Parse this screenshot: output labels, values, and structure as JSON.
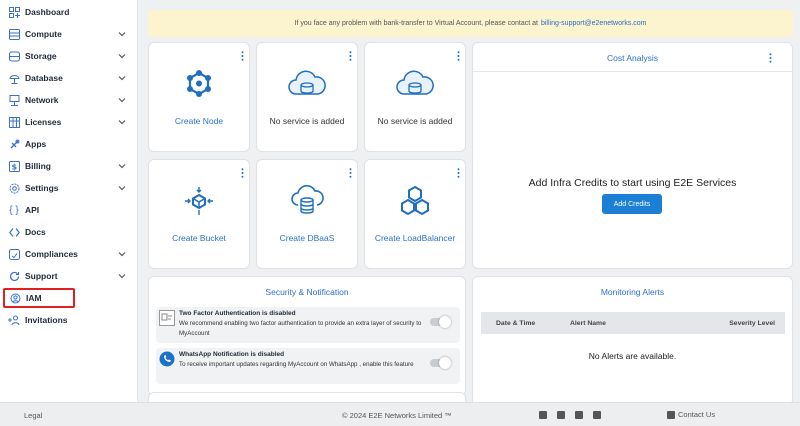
{
  "sidebar": {
    "items": [
      {
        "label": "Dashboard",
        "icon": "dashboard-icon"
      },
      {
        "label": "Compute",
        "icon": "compute-icon"
      },
      {
        "label": "Storage",
        "icon": "storage-icon"
      },
      {
        "label": "Database",
        "icon": "database-icon"
      },
      {
        "label": "Network",
        "icon": "network-icon"
      },
      {
        "label": "Licenses",
        "icon": "licenses-icon"
      },
      {
        "label": "Apps",
        "icon": "apps-icon"
      },
      {
        "label": "Billing",
        "icon": "billing-icon"
      },
      {
        "label": "Settings",
        "icon": "settings-icon"
      },
      {
        "label": "API",
        "icon": "api-icon"
      },
      {
        "label": "Docs",
        "icon": "docs-icon"
      },
      {
        "label": "Compliances",
        "icon": "compliances-icon"
      },
      {
        "label": "Support",
        "icon": "support-icon"
      },
      {
        "label": "IAM",
        "icon": "iam-icon"
      },
      {
        "label": "Invitations",
        "icon": "invitations-icon"
      }
    ]
  },
  "banner": {
    "text": "If you face any problem with bank-transfer to Virtual Account, please contact at",
    "email": "billing-support@e2enetworks.com"
  },
  "tiles": [
    {
      "label": "Create Node",
      "icon": "node-icon"
    },
    {
      "label": "No service is added",
      "icon": "cloud-icon"
    },
    {
      "label": "No service is added",
      "icon": "cloud-icon"
    },
    {
      "label": "Create Bucket",
      "icon": "bucket-icon"
    },
    {
      "label": "Create DBaaS",
      "icon": "dbaas-icon"
    },
    {
      "label": "Create LoadBalancer",
      "icon": "loadbalancer-icon"
    }
  ],
  "cost": {
    "title": "Cost Analysis",
    "message": "Add Infra Credits to start using E2E Services",
    "button": "Add Credits"
  },
  "security": {
    "title": "Security & Notification",
    "notifications": [
      {
        "title": "Two Factor Authentication is disabled",
        "description": "We recommend enabling two factor authentication to provide an extra layer of security to MyAccount"
      },
      {
        "title": "WhatsApp Notification is disabled",
        "description": "To receive important updates regarding MyAccount on WhatsApp , enable this feature"
      }
    ]
  },
  "monitoring": {
    "title": "Monitoring Alerts",
    "columns": [
      "Date & Time",
      "Alert Name",
      "Severity Level"
    ],
    "empty": "No Alerts are available."
  },
  "footer": {
    "legal": "Legal",
    "copyright": "© 2024 E2E Networks Limited ™",
    "contact": "Contact Us"
  },
  "colors": {
    "accent": "#2b72c9",
    "button": "#1c7fd6",
    "banner_bg": "#fcf3cf",
    "highlight_border": "#e02020"
  }
}
